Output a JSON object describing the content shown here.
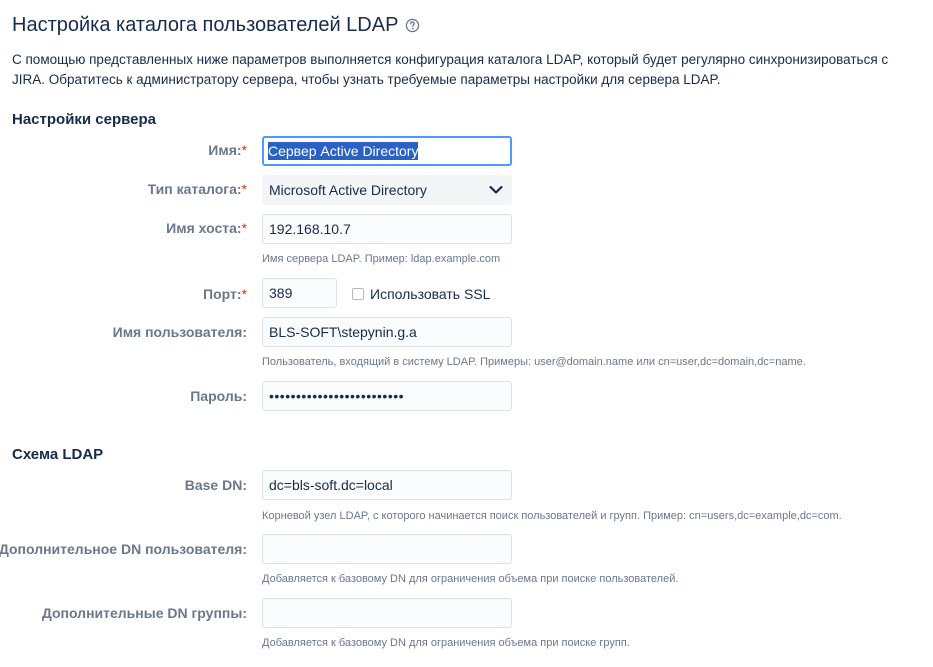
{
  "header": {
    "title": "Настройка каталога пользователей LDAP",
    "help_icon": "question-circle-icon"
  },
  "intro": "С помощью представленных ниже параметров выполняется конфигурация каталога LDAP, который будет регулярно синхронизироваться с JIRA. Обратитесь к администратору сервера, чтобы узнать требуемые параметры настройки для сервера LDAP.",
  "server_settings": {
    "heading": "Настройки сервера",
    "name": {
      "label": "Имя:",
      "required_mark": "*",
      "value": "Сервер Active Directory"
    },
    "directory_type": {
      "label": "Тип каталога:",
      "required_mark": "*",
      "value": "Microsoft Active Directory",
      "icon": "chevron-down-icon"
    },
    "hostname": {
      "label": "Имя хоста:",
      "required_mark": "*",
      "value": "192.168.10.7",
      "hint": "Имя сервера LDAP. Пример: ldap.example.com"
    },
    "port": {
      "label": "Порт:",
      "required_mark": "*",
      "value": "389",
      "ssl_label": "Использовать SSL",
      "ssl_checked": false
    },
    "username": {
      "label": "Имя пользователя:",
      "value": "BLS-SOFT\\stepynin.g.a",
      "hint": "Пользователь, входящий в систему LDAP. Примеры: user@domain.name или cn=user,dc=domain,dc=name."
    },
    "password": {
      "label": "Пароль:",
      "value": "•••••••••••••••••••••••••"
    }
  },
  "ldap_schema": {
    "heading": "Схема LDAP",
    "base_dn": {
      "label": "Base DN:",
      "value": "dc=bls-soft.dc=local",
      "hint": "Корневой узел LDAP, с которого начинается поиск пользователей и групп. Пример: cn=users,dc=example,dc=com."
    },
    "additional_user_dn": {
      "label": "Дополнительное DN пользователя:",
      "value": "",
      "hint": "Добавляется к базовому DN для ограничения объема при поиске пользователей."
    },
    "additional_group_dn": {
      "label": "Дополнительные DN группы:",
      "value": "",
      "hint": "Добавляется к базовому DN для ограничения объема при поиске групп."
    }
  }
}
